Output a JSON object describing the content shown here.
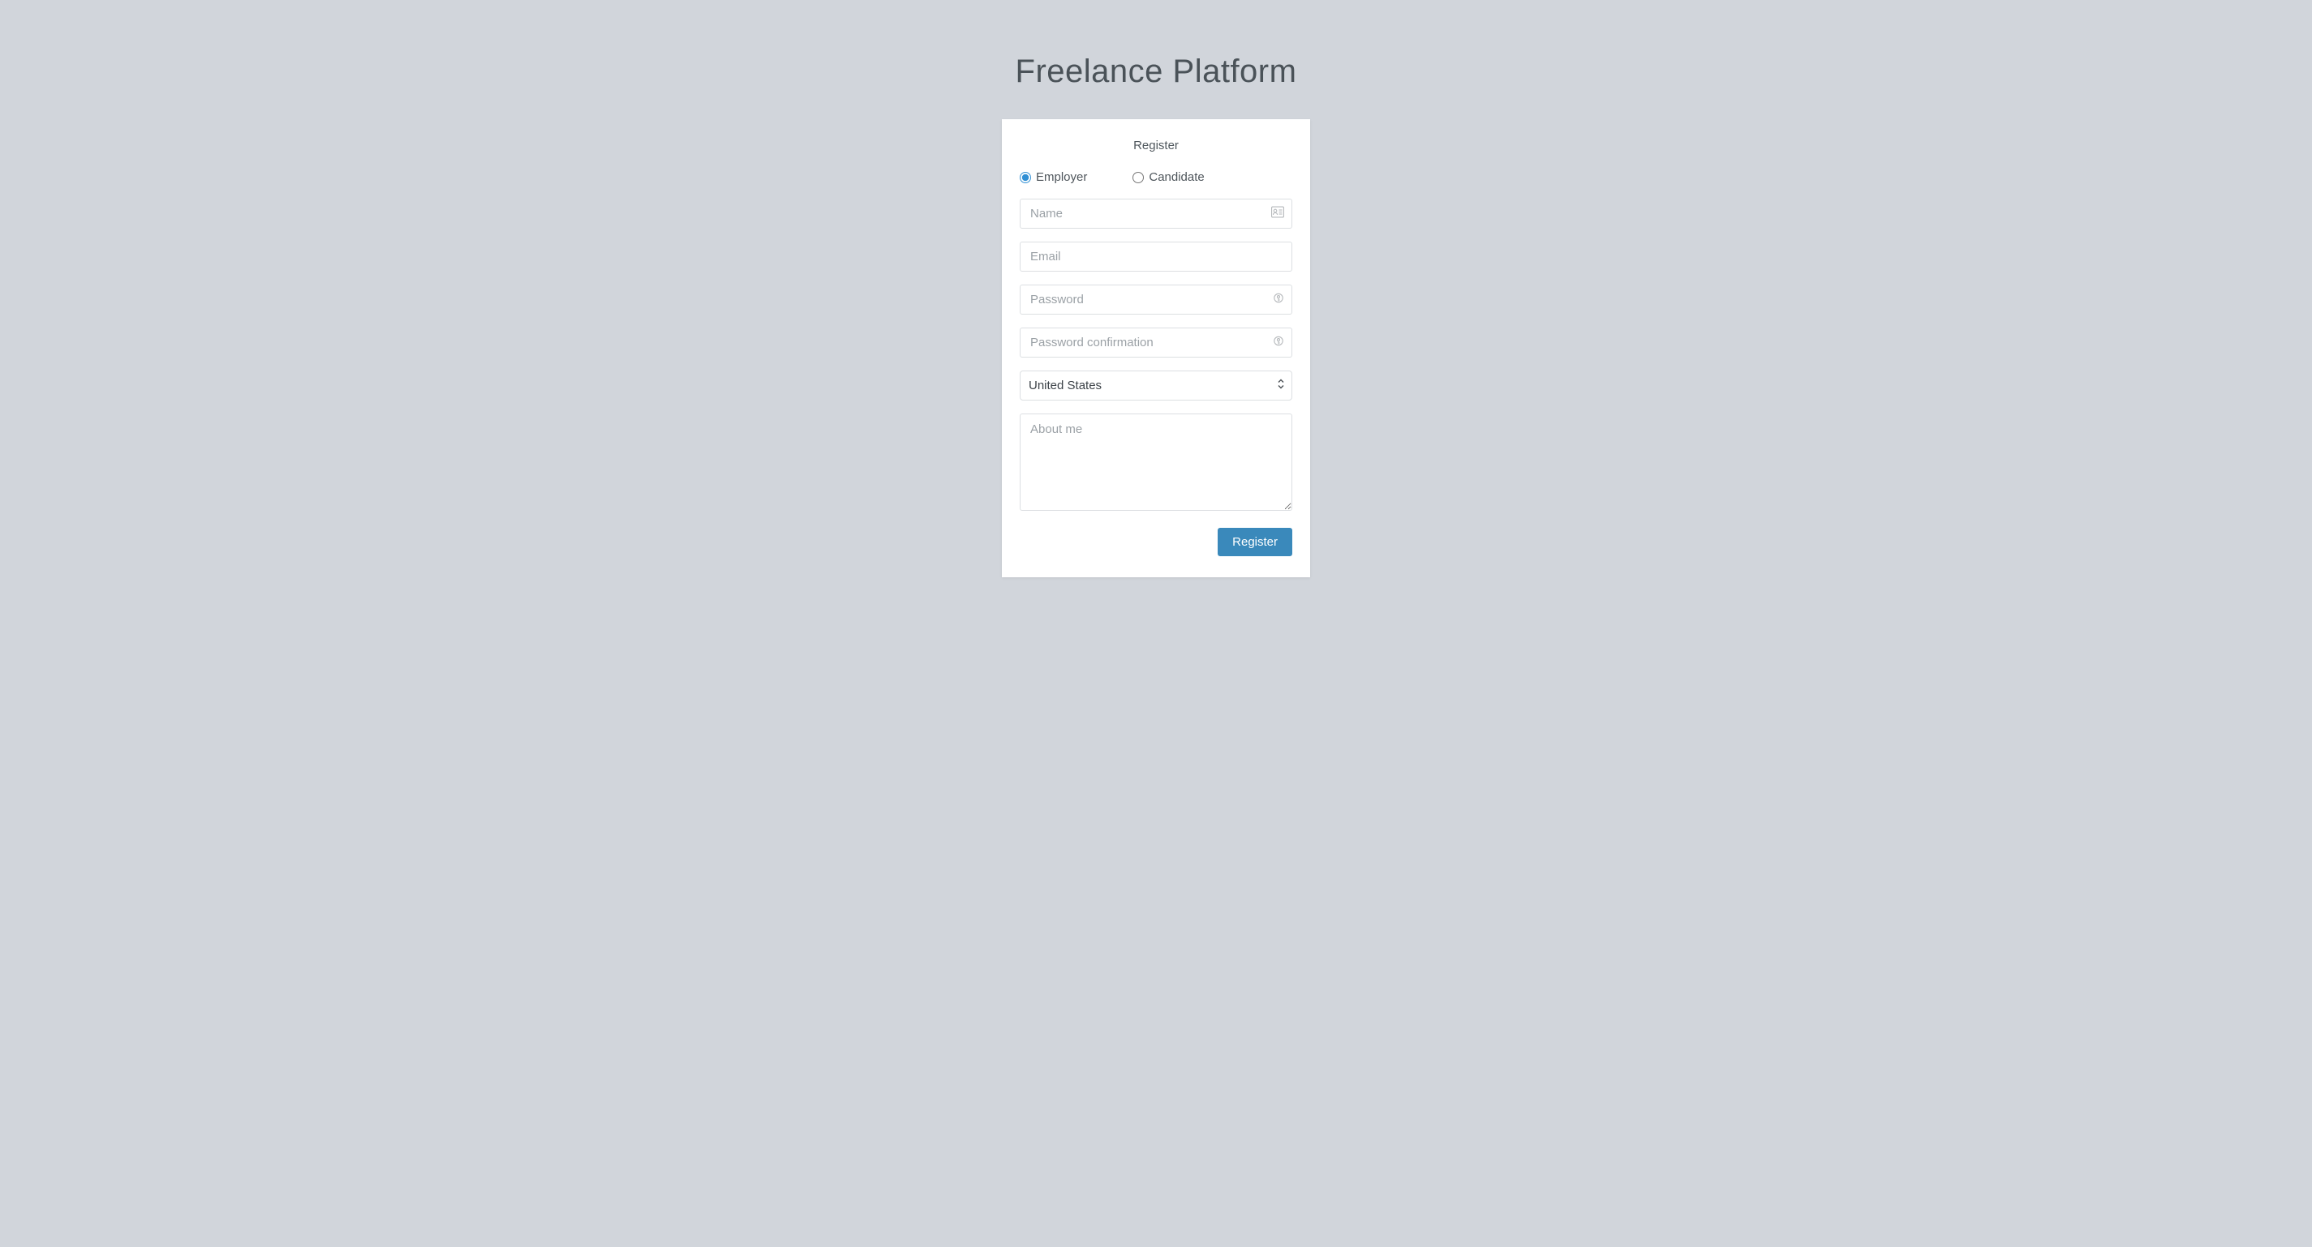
{
  "page": {
    "title": "Freelance Platform"
  },
  "form": {
    "heading": "Register",
    "radios": {
      "employer": "Employer",
      "candidate": "Candidate",
      "selected": "employer"
    },
    "fields": {
      "name_placeholder": "Name",
      "email_placeholder": "Email",
      "password_placeholder": "Password",
      "password_confirmation_placeholder": "Password confirmation",
      "about_placeholder": "About me"
    },
    "country": {
      "selected": "United States"
    },
    "submit_label": "Register"
  }
}
